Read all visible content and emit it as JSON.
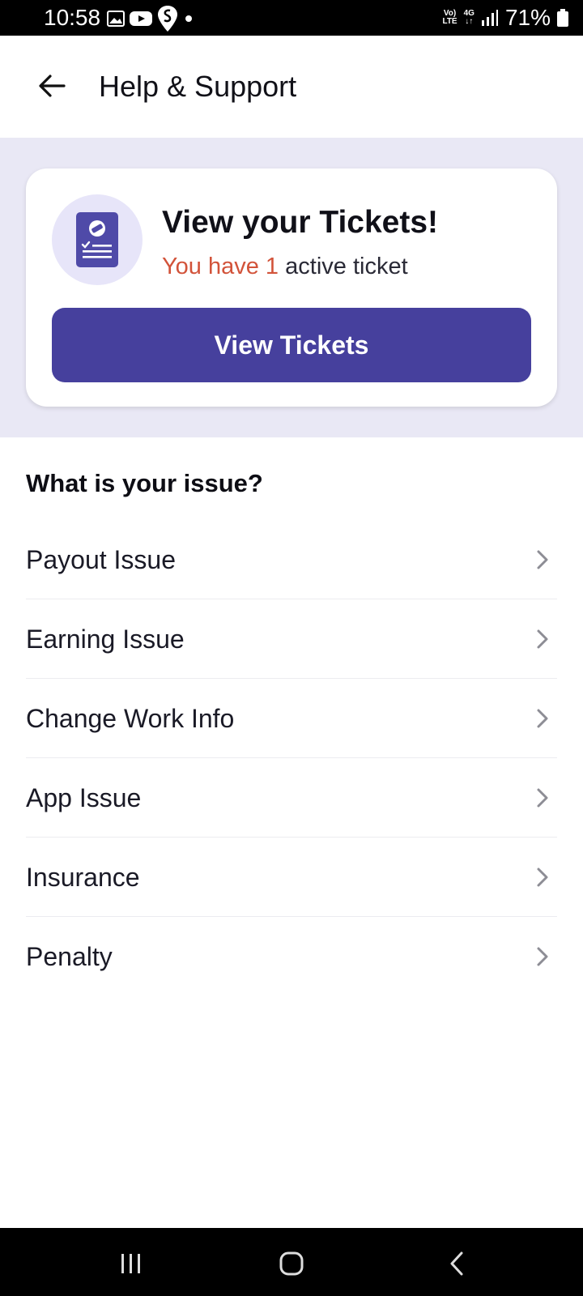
{
  "status_bar": {
    "time": "10:58",
    "network_top": "Vo)",
    "network_bottom": "LTE",
    "signal_type": "4G",
    "battery": "71%"
  },
  "header": {
    "title": "Help & Support"
  },
  "ticket_card": {
    "title": "View your Tickets!",
    "subtitle_highlight": "You have 1",
    "subtitle_rest": " active ticket",
    "button_label": "View Tickets"
  },
  "issues": {
    "heading": "What is your issue?",
    "items": [
      {
        "label": "Payout Issue"
      },
      {
        "label": "Earning Issue"
      },
      {
        "label": "Change Work Info"
      },
      {
        "label": "App Issue"
      },
      {
        "label": "Insurance"
      },
      {
        "label": "Penalty"
      }
    ]
  },
  "colors": {
    "accent": "#46409d",
    "banner_bg": "#e9e8f5",
    "highlight": "#d2533a"
  },
  "icons": {
    "back": "arrow-left-icon",
    "ticket": "ticket-document-icon",
    "chevron": "chevron-right-icon"
  }
}
